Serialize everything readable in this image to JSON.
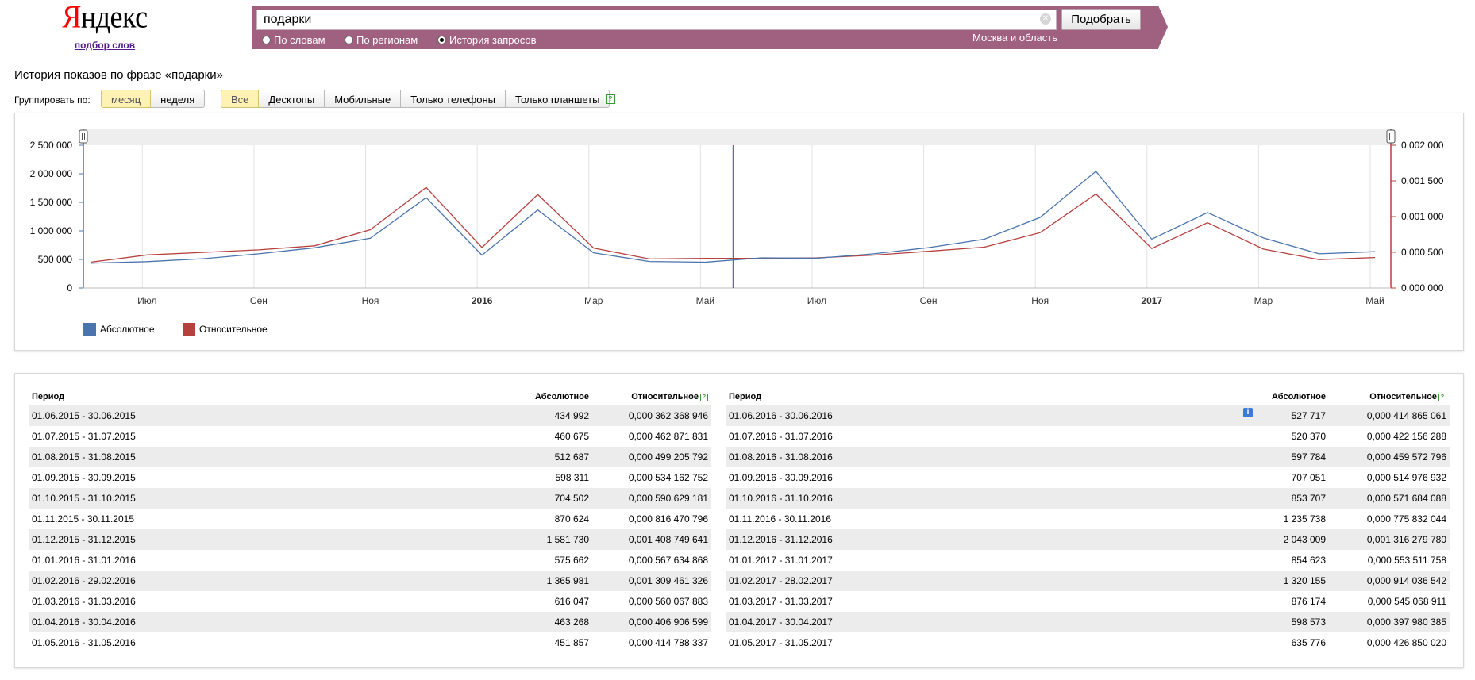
{
  "header": {
    "logo_first_letter": "Я",
    "logo_rest": "ндекс",
    "logo_sub": "подбор слов",
    "search_value": "подарки",
    "submit_label": "Подобрать",
    "radio_words": "По словам",
    "radio_regions": "По регионам",
    "radio_history": "История запросов",
    "region_link": "Москва и область"
  },
  "controls": {
    "title": "История показов по фразе «подарки»",
    "group_label": "Группировать по:",
    "group_month": "месяц",
    "group_week": "неделя",
    "dev_all": "Все",
    "dev_desktop": "Десктопы",
    "dev_mobile": "Мобильные",
    "dev_phones": "Только телефоны",
    "dev_tablets": "Только планшеты",
    "help": "?"
  },
  "legend": {
    "absolute": "Абсолютное",
    "relative": "Относительное"
  },
  "colors": {
    "absolute": "#4a74ad",
    "relative": "#b6403e",
    "accent_band": "#a06080"
  },
  "chart_data": {
    "type": "line",
    "categories": [
      "06.2015",
      "07.2015",
      "08.2015",
      "09.2015",
      "10.2015",
      "11.2015",
      "12.2015",
      "01.2016",
      "02.2016",
      "03.2016",
      "04.2016",
      "05.2016",
      "06.2016",
      "07.2016",
      "08.2016",
      "09.2016",
      "10.2016",
      "11.2016",
      "12.2016",
      "01.2017",
      "02.2017",
      "03.2017",
      "04.2017",
      "05.2017"
    ],
    "x_tick_labels": [
      {
        "label": "Июл",
        "at": 1,
        "bold": false
      },
      {
        "label": "Сен",
        "at": 3,
        "bold": false
      },
      {
        "label": "Ноя",
        "at": 5,
        "bold": false
      },
      {
        "label": "2016",
        "at": 7,
        "bold": true
      },
      {
        "label": "Мар",
        "at": 9,
        "bold": false
      },
      {
        "label": "Май",
        "at": 11,
        "bold": false
      },
      {
        "label": "Июл",
        "at": 13,
        "bold": false
      },
      {
        "label": "Сен",
        "at": 15,
        "bold": false
      },
      {
        "label": "Ноя",
        "at": 17,
        "bold": false
      },
      {
        "label": "2017",
        "at": 19,
        "bold": true
      },
      {
        "label": "Мар",
        "at": 21,
        "bold": false
      },
      {
        "label": "Май",
        "at": 23,
        "bold": false
      }
    ],
    "y_left": {
      "ticks": [
        "0",
        "500 000",
        "1 000 000",
        "1 500 000",
        "2 000 000",
        "2 500 000"
      ],
      "lim": [
        0,
        2500000
      ]
    },
    "y_right": {
      "ticks": [
        "0,000 000",
        "0,000 500",
        "0,001 000",
        "0,001 500",
        "0,002 000"
      ],
      "lim": [
        0,
        0.002
      ]
    },
    "divider_at": 11.5,
    "series": [
      {
        "name": "Абсолютное",
        "axis": "left",
        "values": [
          434992,
          460675,
          512687,
          598311,
          704502,
          870624,
          1581730,
          575662,
          1365981,
          616047,
          463268,
          451857,
          527717,
          520370,
          597784,
          707051,
          853707,
          1235738,
          2043009,
          854623,
          1320155,
          876174,
          598573,
          635776
        ]
      },
      {
        "name": "Относительное",
        "axis": "right",
        "values": [
          0.000362368946,
          0.000462871831,
          0.000499205792,
          0.000534162752,
          0.000590629181,
          0.000816470796,
          0.001408749641,
          0.000567634868,
          0.001309461326,
          0.000560067883,
          0.000406906599,
          0.000414788337,
          0.000414865061,
          0.000422156288,
          0.000459572796,
          0.000514976932,
          0.000571684088,
          0.000775832044,
          0.00131627978,
          0.000553511758,
          0.000914036542,
          0.000545068911,
          0.000397980385,
          0.00042685002
        ]
      }
    ]
  },
  "table": {
    "headers": {
      "period": "Период",
      "absolute": "Абсолютное",
      "relative": "Относительное"
    },
    "left": [
      [
        "01.06.2015 - 30.06.2015",
        "434 992",
        "0,000 362 368 946"
      ],
      [
        "01.07.2015 - 31.07.2015",
        "460 675",
        "0,000 462 871 831"
      ],
      [
        "01.08.2015 - 31.08.2015",
        "512 687",
        "0,000 499 205 792"
      ],
      [
        "01.09.2015 - 30.09.2015",
        "598 311",
        "0,000 534 162 752"
      ],
      [
        "01.10.2015 - 31.10.2015",
        "704 502",
        "0,000 590 629 181"
      ],
      [
        "01.11.2015 - 30.11.2015",
        "870 624",
        "0,000 816 470 796"
      ],
      [
        "01.12.2015 - 31.12.2015",
        "1 581 730",
        "0,001 408 749 641"
      ],
      [
        "01.01.2016 - 31.01.2016",
        "575 662",
        "0,000 567 634 868"
      ],
      [
        "01.02.2016 - 29.02.2016",
        "1 365 981",
        "0,001 309 461 326"
      ],
      [
        "01.03.2016 - 31.03.2016",
        "616 047",
        "0,000 560 067 883"
      ],
      [
        "01.04.2016 - 30.04.2016",
        "463 268",
        "0,000 406 906 599"
      ],
      [
        "01.05.2016 - 31.05.2016",
        "451 857",
        "0,000 414 788 337"
      ]
    ],
    "right": [
      [
        "01.06.2016 - 30.06.2016",
        "527 717",
        "0,000 414 865 061"
      ],
      [
        "01.07.2016 - 31.07.2016",
        "520 370",
        "0,000 422 156 288"
      ],
      [
        "01.08.2016 - 31.08.2016",
        "597 784",
        "0,000 459 572 796"
      ],
      [
        "01.09.2016 - 30.09.2016",
        "707 051",
        "0,000 514 976 932"
      ],
      [
        "01.10.2016 - 31.10.2016",
        "853 707",
        "0,000 571 684 088"
      ],
      [
        "01.11.2016 - 30.11.2016",
        "1 235 738",
        "0,000 775 832 044"
      ],
      [
        "01.12.2016 - 31.12.2016",
        "2 043 009",
        "0,001 316 279 780"
      ],
      [
        "01.01.2017 - 31.01.2017",
        "854 623",
        "0,000 553 511 758"
      ],
      [
        "01.02.2017 - 28.02.2017",
        "1 320 155",
        "0,000 914 036 542"
      ],
      [
        "01.03.2017 - 31.03.2017",
        "876 174",
        "0,000 545 068 911"
      ],
      [
        "01.04.2017 - 30.04.2017",
        "598 573",
        "0,000 397 980 385"
      ],
      [
        "01.05.2017 - 31.05.2017",
        "635 776",
        "0,000 426 850 020"
      ]
    ],
    "info": "i"
  }
}
